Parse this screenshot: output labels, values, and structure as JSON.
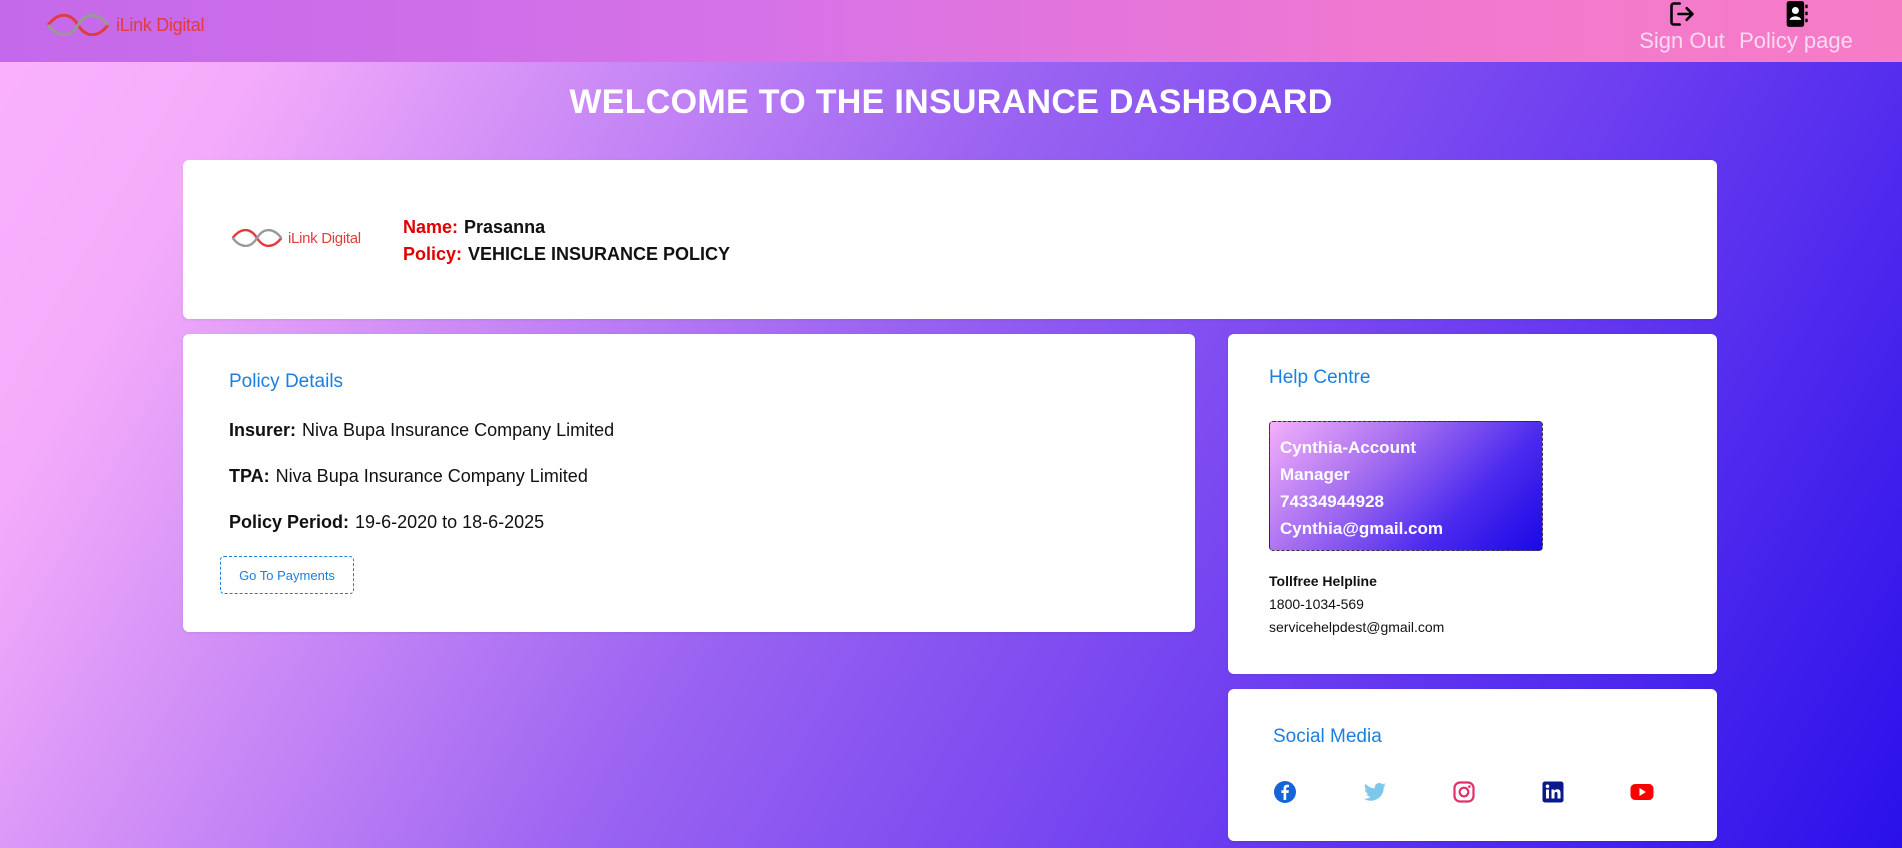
{
  "header": {
    "brand": "iLink Digital",
    "nav": [
      {
        "label": "Sign Out",
        "icon": "sign-out-icon"
      },
      {
        "label": "Policy page",
        "icon": "contact-book-icon"
      }
    ]
  },
  "welcome": "WELCOME TO THE INSURANCE DASHBOARD",
  "profile": {
    "logo_text": "iLink Digital",
    "name_label": "Name:",
    "name": "Prasanna",
    "policy_label": "Policy:",
    "policy": "VEHICLE INSURANCE POLICY"
  },
  "policy_details": {
    "title": "Policy Details",
    "rows": [
      {
        "label": "Insurer:",
        "value": "Niva Bupa Insurance Company Limited"
      },
      {
        "label": "TPA:",
        "value": "Niva Bupa Insurance Company Limited"
      },
      {
        "label": "Policy Period:",
        "value": "19-6-2020 to 18-6-2025"
      }
    ],
    "button": "Go To Payments"
  },
  "help_centre": {
    "title": "Help Centre",
    "manager": [
      "Cynthia-Account",
      "Manager",
      "74334944928",
      "Cynthia@gmail.com"
    ],
    "tollfree_title": "Tollfree Helpline",
    "tollfree_number": "1800-1034-569",
    "tollfree_email": "servicehelpdest@gmail.com"
  },
  "social_media": {
    "title": "Social Media",
    "icons": [
      {
        "name": "facebook-icon",
        "color": "#1565d8"
      },
      {
        "name": "twitter-icon",
        "color": "#7cc7ea"
      },
      {
        "name": "instagram-icon",
        "color": "#e1306c"
      },
      {
        "name": "linkedin-icon",
        "color": "#0a1a8a"
      },
      {
        "name": "youtube-icon",
        "color": "#ff0000"
      }
    ]
  },
  "colors": {
    "accent_blue": "#1c7fe0",
    "label_red": "#e00000",
    "brand_red": "#e33b3b"
  }
}
